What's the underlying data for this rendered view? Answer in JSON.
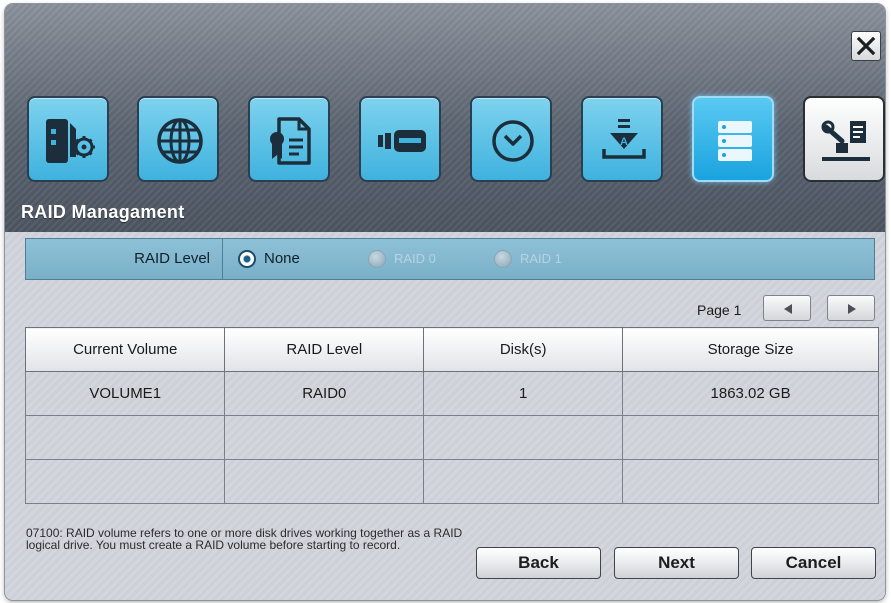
{
  "dialog": {
    "title": "RAID Managament",
    "close_icon": "close-icon",
    "toolbar_icons": [
      {
        "name": "server-settings-icon",
        "active": false
      },
      {
        "name": "network-globe-icon",
        "active": false
      },
      {
        "name": "document-certificate-icon",
        "active": false
      },
      {
        "name": "storage-card-icon",
        "active": false
      },
      {
        "name": "clock-icon",
        "active": false
      },
      {
        "name": "download-record-icon",
        "active": false
      },
      {
        "name": "raid-stack-icon",
        "active": true
      },
      {
        "name": "tools-icon",
        "active": false
      }
    ]
  },
  "raid_level": {
    "label": "RAID Level",
    "options": [
      {
        "label": "None",
        "selected": true,
        "enabled": true
      },
      {
        "label": "RAID 0",
        "selected": false,
        "enabled": false
      },
      {
        "label": "RAID 1",
        "selected": false,
        "enabled": false
      }
    ]
  },
  "pager": {
    "label": "Page 1",
    "prev_icon": "triangle-left-icon",
    "next_icon": "triangle-right-icon"
  },
  "table": {
    "headers": [
      "Current Volume",
      "RAID Level",
      "Disk(s)",
      "Storage Size"
    ],
    "rows": [
      [
        "VOLUME1",
        "RAID0",
        "1",
        "1863.02 GB"
      ],
      [
        "",
        "",
        "",
        ""
      ],
      [
        "",
        "",
        "",
        ""
      ]
    ]
  },
  "hint": "07100: RAID volume refers to one or more disk drives working together as a RAID logical drive. You must create a RAID volume before starting to record.",
  "buttons": {
    "back": "Back",
    "next": "Next",
    "cancel": "Cancel"
  },
  "colors": {
    "accent": "#3fb2de",
    "bar": "#86b9d0"
  }
}
